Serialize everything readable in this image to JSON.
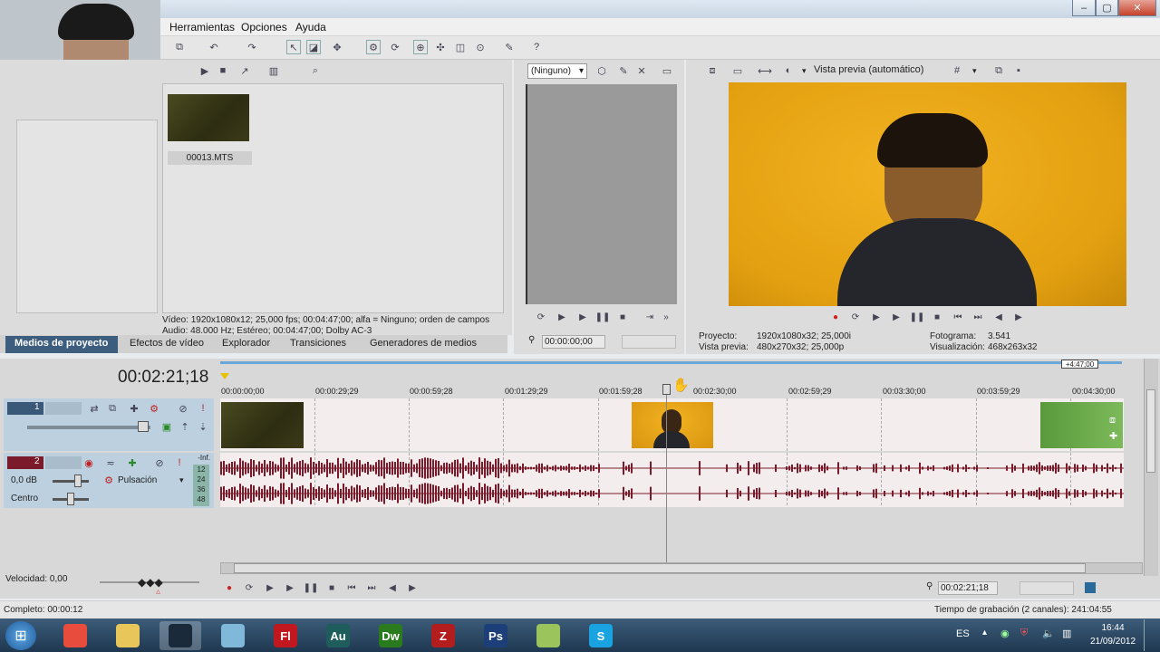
{
  "menu": {
    "herramientas": "Herramientas",
    "opciones": "Opciones",
    "ayuda": "Ayuda"
  },
  "media": {
    "clip_name": "00013.MTS"
  },
  "clip_info": {
    "video": "Vídeo: 1920x1080x12; 25,000 fps; 00:04:47;00; alfa = Ninguno; orden de campos",
    "audio": "Audio: 48.000 Hz; Estéreo; 00:04:47;00; Dolby AC-3"
  },
  "tabs": [
    "Medios de proyecto",
    "Efectos de vídeo",
    "Explorador",
    "Transiciones",
    "Generadores de medios"
  ],
  "trimmer": {
    "select_value": "(Ninguno)",
    "timecode": "00:00:00;00"
  },
  "preview": {
    "mode_label": "Vista previa (automático)",
    "proyecto_label": "Proyecto:",
    "proyecto_value": "1920x1080x32; 25,000i",
    "vista_label": "Vista previa:",
    "vista_value": "480x270x32; 25,000p",
    "fotograma_label": "Fotograma:",
    "fotograma_value": "3.541",
    "visualizacion_label": "Visualización:",
    "visualizacion_value": "468x263x32"
  },
  "timeline": {
    "timecode": "00:02:21;18",
    "end_marker": "+4:47;00",
    "ruler": [
      "00:00:00;00",
      "00:00:29;29",
      "00:00:59;28",
      "00:01:29;29",
      "00:01:59;28",
      "00:02:30;00",
      "00:02:59;29",
      "00:03:30;00",
      "00:03:59;29",
      "00:04:30;00"
    ],
    "track1_num": "1",
    "track2_num": "2",
    "volume": "0,0 dB",
    "pan": "Centro",
    "pulse": "Pulsación",
    "meter_top": "-Inf.",
    "meter_ticks": [
      "12",
      "24",
      "36",
      "48"
    ],
    "velocidad": "Velocidad: 0,00",
    "bottom_timecode": "00:02:21;18"
  },
  "status": {
    "completo": "Completo: 00:00:12",
    "grabacion": "Tiempo de grabación (2 canales): 241:04:55"
  },
  "taskbar": {
    "lang": "ES",
    "time": "16:44",
    "date": "21/09/2012",
    "apps": [
      {
        "name": "chrome-icon",
        "label": "",
        "color": "#e74c3c"
      },
      {
        "name": "folder-icon",
        "label": "",
        "color": "#e8c65a"
      },
      {
        "name": "vegas-icon",
        "label": "",
        "color": "#1a2a3a"
      },
      {
        "name": "notepad-icon",
        "label": "",
        "color": "#7fb8d9"
      },
      {
        "name": "flash-icon",
        "label": "Fl",
        "color": "#c0181e"
      },
      {
        "name": "audition-icon",
        "label": "Au",
        "color": "#1f5c5c"
      },
      {
        "name": "dreamweaver-icon",
        "label": "Dw",
        "color": "#2a7b1e"
      },
      {
        "name": "filezilla-icon",
        "label": "Z",
        "color": "#b21e1e"
      },
      {
        "name": "photoshop-icon",
        "label": "Ps",
        "color": "#1c3f7a"
      },
      {
        "name": "notes-icon",
        "label": "",
        "color": "#9bc45c"
      },
      {
        "name": "skype-icon",
        "label": "S",
        "color": "#19a3e0"
      }
    ]
  }
}
